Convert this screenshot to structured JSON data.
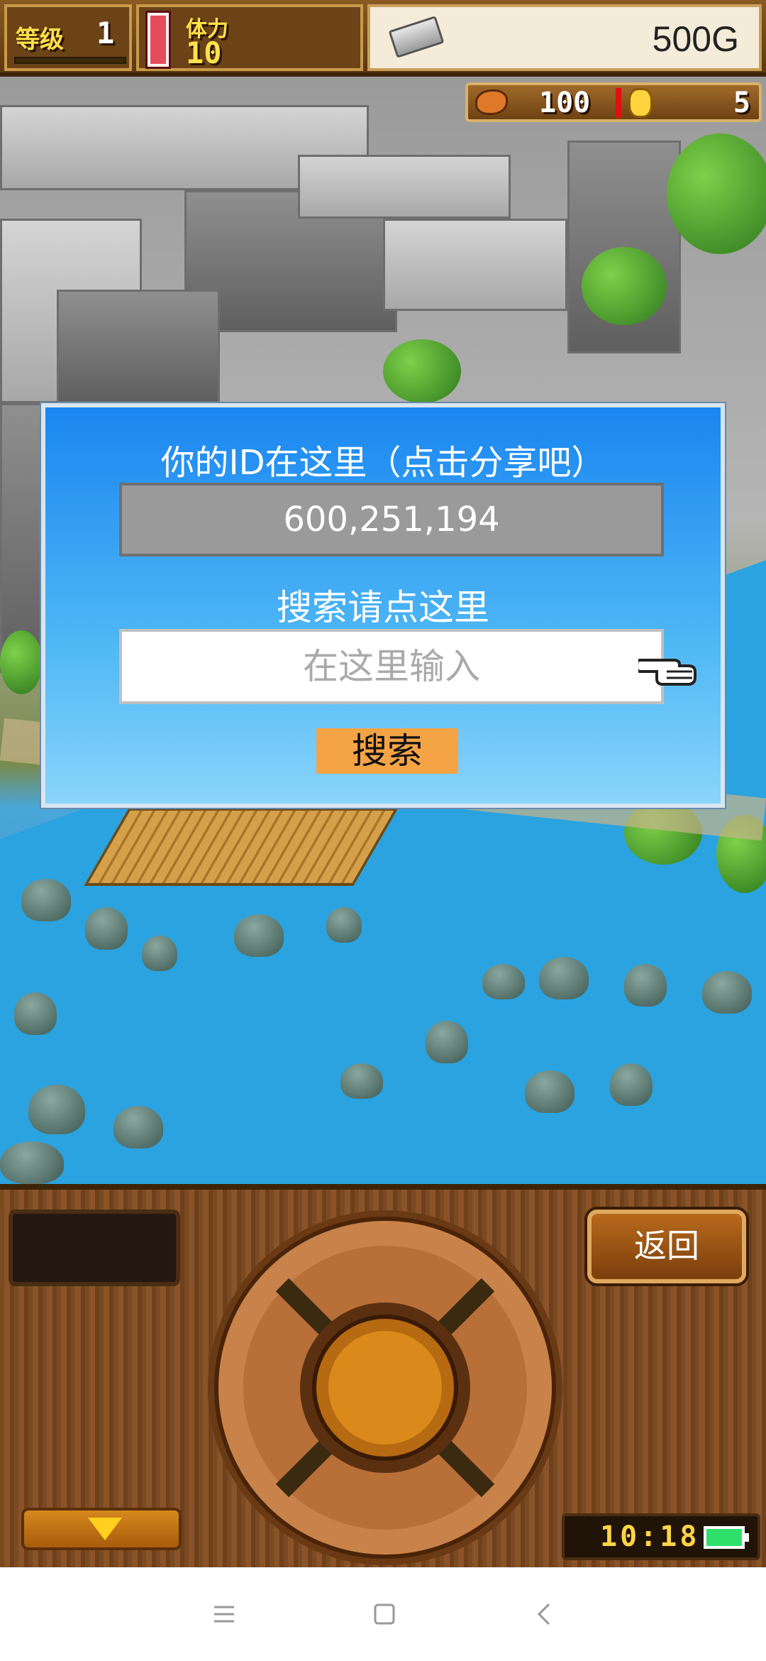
{
  "hud": {
    "level_label": "等级",
    "level_value": "1",
    "stamina_label": "体力",
    "stamina_value": "10",
    "gold": "500G",
    "food_value": "100",
    "medal_value": "5"
  },
  "dialog": {
    "id_title": "你的ID在这里（点击分享吧）",
    "id_value": "600,251,194",
    "search_title": "搜索请点这里",
    "search_placeholder": "在这里输入",
    "search_button": "搜索"
  },
  "panel": {
    "back_button": "返回",
    "clock": "10:18"
  },
  "colors": {
    "dialog_top": "#1a86f0",
    "dialog_bottom": "#8ad4fb",
    "search_button": "#f5a445",
    "id_box": "#9a9a9a",
    "wood": "#7a4a22"
  },
  "icons": [
    "gold-bar-icon",
    "food-icon",
    "coin-icon",
    "pointing-hand-icon",
    "down-arrow-icon",
    "battery-icon",
    "menu-icon",
    "home-icon",
    "back-icon"
  ]
}
